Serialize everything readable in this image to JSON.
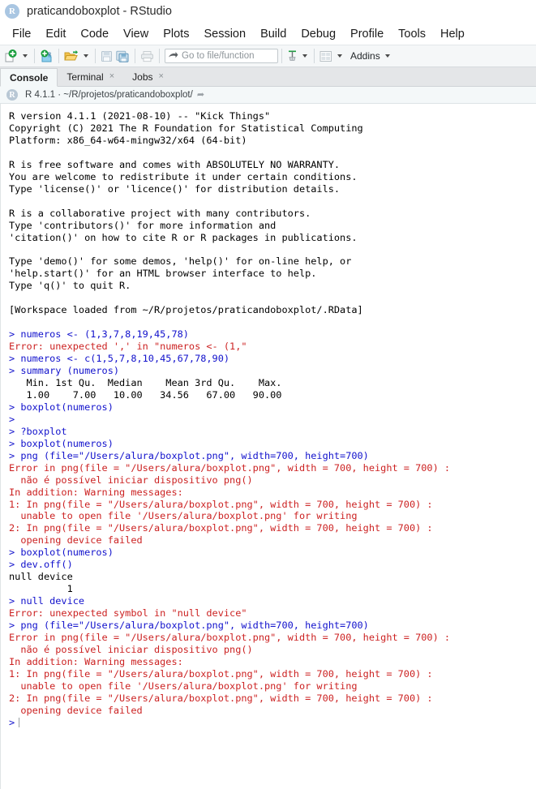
{
  "window": {
    "title": "praticandoboxplot - RStudio",
    "logo_letter": "R"
  },
  "menubar": {
    "items": [
      {
        "label": "File"
      },
      {
        "label": "Edit"
      },
      {
        "label": "Code"
      },
      {
        "label": "View"
      },
      {
        "label": "Plots"
      },
      {
        "label": "Session"
      },
      {
        "label": "Build"
      },
      {
        "label": "Debug"
      },
      {
        "label": "Profile"
      },
      {
        "label": "Tools"
      },
      {
        "label": "Help"
      }
    ]
  },
  "toolbar": {
    "new_file_icon": "new-file-plus-icon",
    "new_project_icon": "new-project-icon",
    "open_file_icon": "open-folder-icon",
    "save_icon": "save-disk-icon",
    "save_all_icon": "save-all-disks-icon",
    "print_icon": "printer-icon",
    "goto_icon": "arrow-forward-icon",
    "goto_placeholder": "Go to file/function",
    "workspace_icon": "workspace-broom-icon",
    "panes_icon": "pane-layout-icon",
    "addins_label": "Addins"
  },
  "tabs": [
    {
      "label": "Console",
      "active": true,
      "closable": false
    },
    {
      "label": "Terminal",
      "active": false,
      "closable": true
    },
    {
      "label": "Jobs",
      "active": false,
      "closable": true
    }
  ],
  "console_header": {
    "badge": "R",
    "version_path": "R 4.1.1  ·  ~/R/projetos/praticandoboxplot/",
    "share_icon": "share-arrow-icon"
  },
  "console": {
    "prompt_symbol": ">",
    "lines": [
      {
        "text": "R version 4.1.1 (2021-08-10) -- \"Kick Things\"",
        "color": "black"
      },
      {
        "text": "Copyright (C) 2021 The R Foundation for Statistical Computing",
        "color": "black"
      },
      {
        "text": "Platform: x86_64-w64-mingw32/x64 (64-bit)",
        "color": "black"
      },
      {
        "text": "",
        "color": "black"
      },
      {
        "text": "R is free software and comes with ABSOLUTELY NO WARRANTY.",
        "color": "black"
      },
      {
        "text": "You are welcome to redistribute it under certain conditions.",
        "color": "black"
      },
      {
        "text": "Type 'license()' or 'licence()' for distribution details.",
        "color": "black"
      },
      {
        "text": "",
        "color": "black"
      },
      {
        "text": "R is a collaborative project with many contributors.",
        "color": "black"
      },
      {
        "text": "Type 'contributors()' for more information and",
        "color": "black"
      },
      {
        "text": "'citation()' on how to cite R or R packages in publications.",
        "color": "black"
      },
      {
        "text": "",
        "color": "black"
      },
      {
        "text": "Type 'demo()' for some demos, 'help()' for on-line help, or",
        "color": "black"
      },
      {
        "text": "'help.start()' for an HTML browser interface to help.",
        "color": "black"
      },
      {
        "text": "Type 'q()' to quit R.",
        "color": "black"
      },
      {
        "text": "",
        "color": "black"
      },
      {
        "text": "[Workspace loaded from ~/R/projetos/praticandoboxplot/.RData]",
        "color": "black"
      },
      {
        "text": "",
        "color": "black"
      },
      {
        "text": "> numeros <- (1,3,7,8,19,45,78)",
        "color": "blue"
      },
      {
        "text": "Error: unexpected ',' in \"numeros <- (1,\"",
        "color": "red"
      },
      {
        "text": "> numeros <- c(1,5,7,8,10,45,67,78,90)",
        "color": "blue"
      },
      {
        "text": "> summary (numeros)",
        "color": "blue"
      },
      {
        "text": "   Min. 1st Qu.  Median    Mean 3rd Qu.    Max.",
        "color": "black"
      },
      {
        "text": "   1.00    7.00   10.00   34.56   67.00   90.00",
        "color": "black"
      },
      {
        "text": "> boxplot(numeros)",
        "color": "blue"
      },
      {
        "text": ">",
        "color": "blue"
      },
      {
        "text": "> ?boxplot",
        "color": "blue"
      },
      {
        "text": "> boxplot(numeros)",
        "color": "blue"
      },
      {
        "text": "> png (file=\"/Users/alura/boxplot.png\", width=700, height=700)",
        "color": "blue"
      },
      {
        "text": "Error in png(file = \"/Users/alura/boxplot.png\", width = 700, height = 700) :",
        "color": "red"
      },
      {
        "text": "  não é possível iniciar dispositivo png()",
        "color": "red"
      },
      {
        "text": "In addition: Warning messages:",
        "color": "red"
      },
      {
        "text": "1: In png(file = \"/Users/alura/boxplot.png\", width = 700, height = 700) :",
        "color": "red"
      },
      {
        "text": "  unable to open file '/Users/alura/boxplot.png' for writing",
        "color": "red"
      },
      {
        "text": "2: In png(file = \"/Users/alura/boxplot.png\", width = 700, height = 700) :",
        "color": "red"
      },
      {
        "text": "  opening device failed",
        "color": "red"
      },
      {
        "text": "> boxplot(numeros)",
        "color": "blue"
      },
      {
        "text": "> dev.off()",
        "color": "blue"
      },
      {
        "text": "null device",
        "color": "black"
      },
      {
        "text": "          1",
        "color": "black"
      },
      {
        "text": "> null device",
        "color": "blue"
      },
      {
        "text": "Error: unexpected symbol in \"null device\"",
        "color": "red"
      },
      {
        "text": "> png (file=\"/Users/alura/boxplot.png\", width=700, height=700)",
        "color": "blue"
      },
      {
        "text": "Error in png(file = \"/Users/alura/boxplot.png\", width = 700, height = 700) :",
        "color": "red"
      },
      {
        "text": "  não é possível iniciar dispositivo png()",
        "color": "red"
      },
      {
        "text": "In addition: Warning messages:",
        "color": "red"
      },
      {
        "text": "1: In png(file = \"/Users/alura/boxplot.png\", width = 700, height = 700) :",
        "color": "red"
      },
      {
        "text": "  unable to open file '/Users/alura/boxplot.png' for writing",
        "color": "red"
      },
      {
        "text": "2: In png(file = \"/Users/alura/boxplot.png\", width = 700, height = 700) :",
        "color": "red"
      },
      {
        "text": "  opening device failed",
        "color": "red"
      }
    ]
  },
  "colors": {
    "command": "#1111cc",
    "error": "#cc2222",
    "output": "#000000",
    "toolbar_bg": "#f5f7f8",
    "tabstrip_bg": "#e4e6e8",
    "console_head_bg": "#f4f8f9"
  }
}
